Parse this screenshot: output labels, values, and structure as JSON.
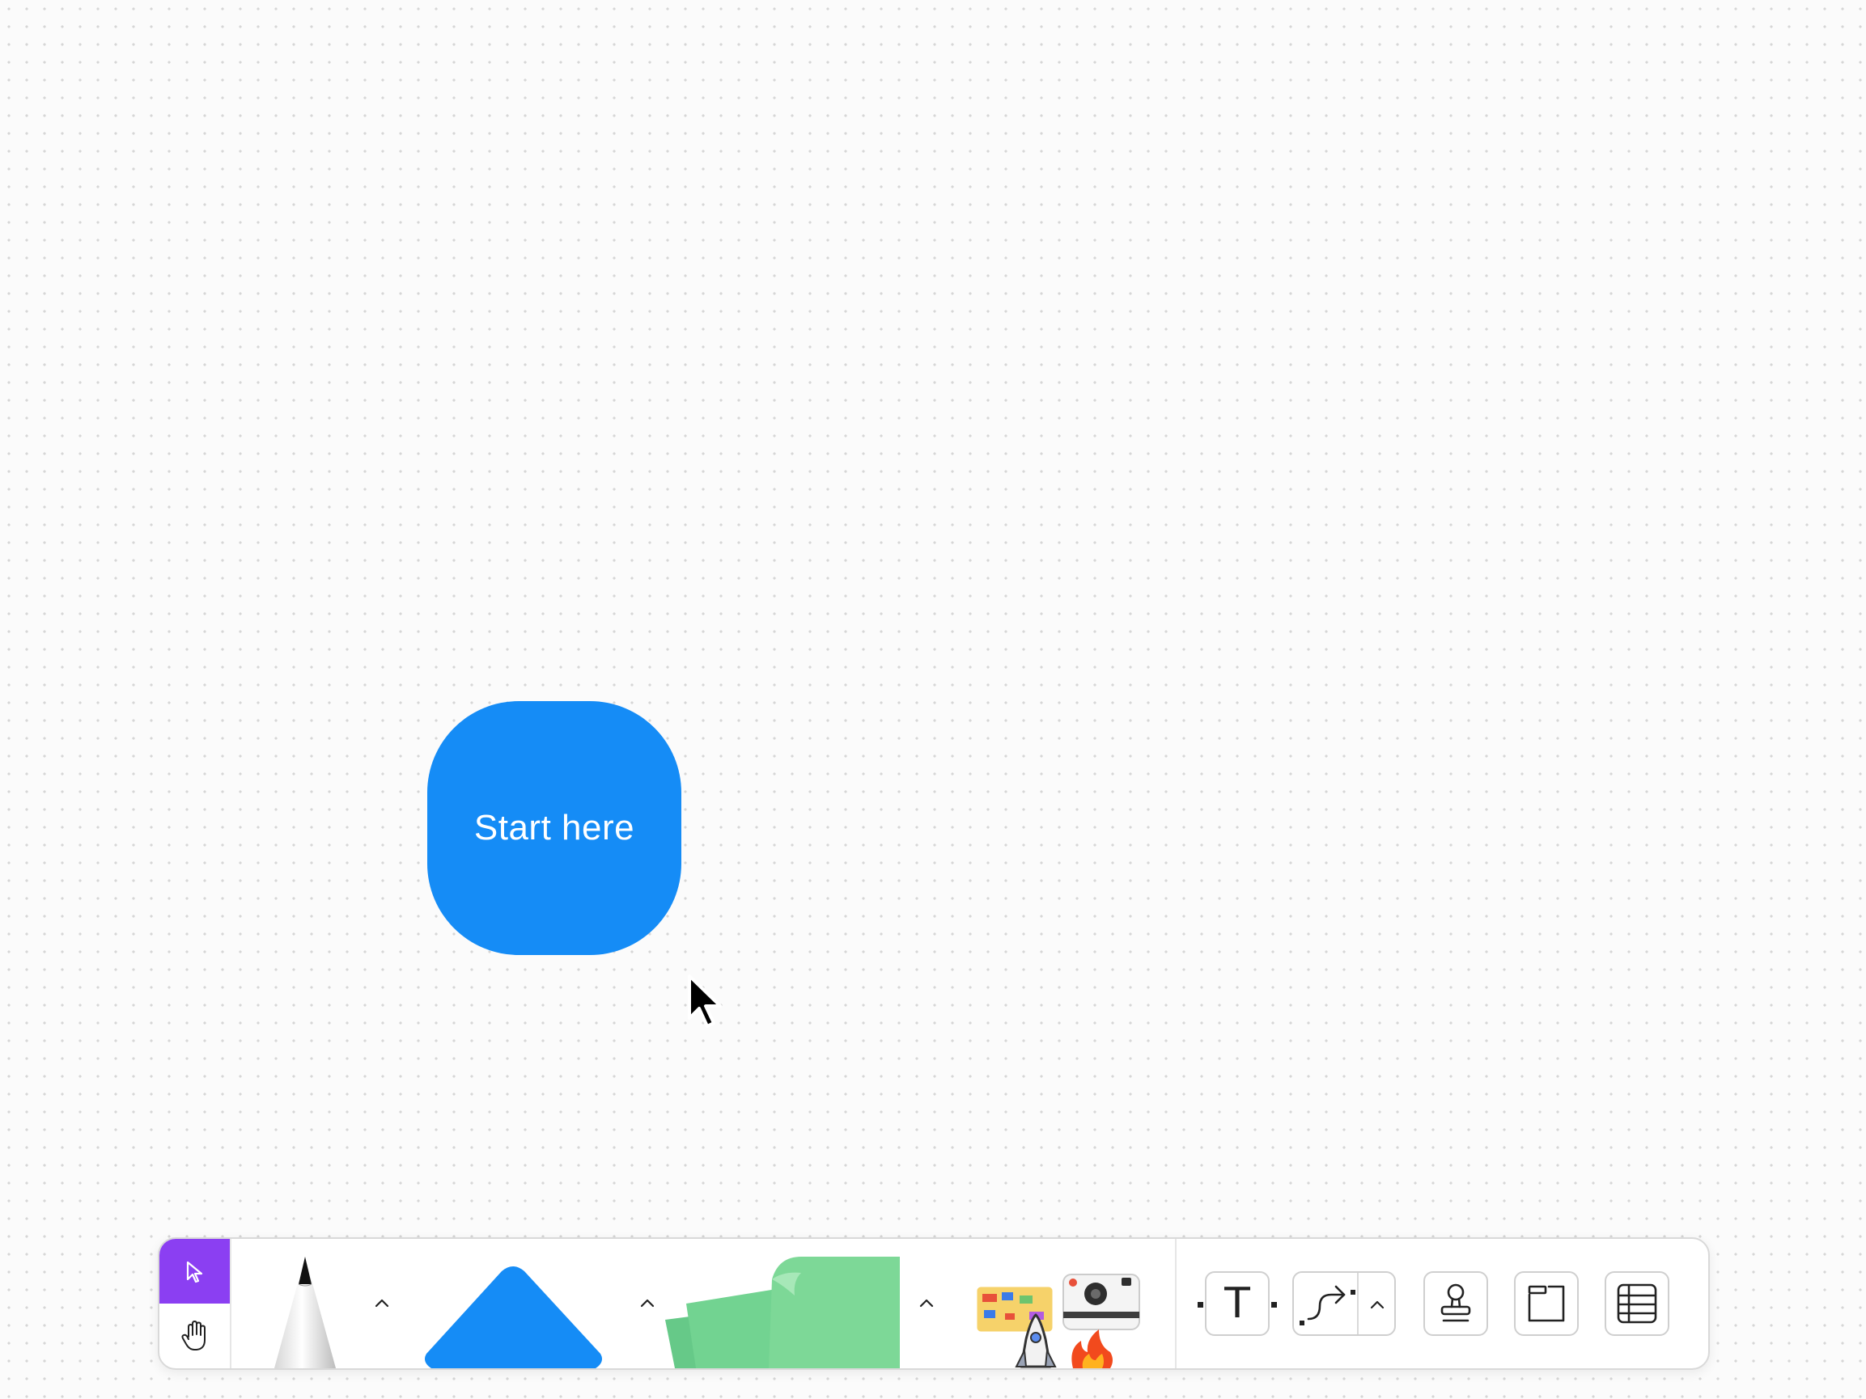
{
  "canvas": {
    "shape_label": "Start here",
    "shape_color": "#158cf6",
    "background_color": "#fbfbfb",
    "dot_color": "#d6d6d6"
  },
  "toolbar": {
    "accent_color": "#8b3ff2",
    "tools": [
      {
        "name": "select",
        "icon": "arrow-pointer-icon",
        "active": true
      },
      {
        "name": "hand",
        "icon": "hand-icon"
      },
      {
        "name": "pen",
        "icon": "pencil-icon"
      },
      {
        "name": "shapes",
        "icon": "triangle-shape-icon",
        "color": "#158cf6"
      },
      {
        "name": "sticky-notes",
        "icon": "sticky-note-icon",
        "color": "#7dd897"
      },
      {
        "name": "stickers",
        "icon": "stickers-icon"
      },
      {
        "name": "text",
        "icon": "text-icon",
        "glyph": "T"
      },
      {
        "name": "connector",
        "icon": "connector-icon"
      },
      {
        "name": "stamp",
        "icon": "stamp-icon"
      },
      {
        "name": "section",
        "icon": "section-icon"
      },
      {
        "name": "table",
        "icon": "table-icon"
      }
    ]
  }
}
